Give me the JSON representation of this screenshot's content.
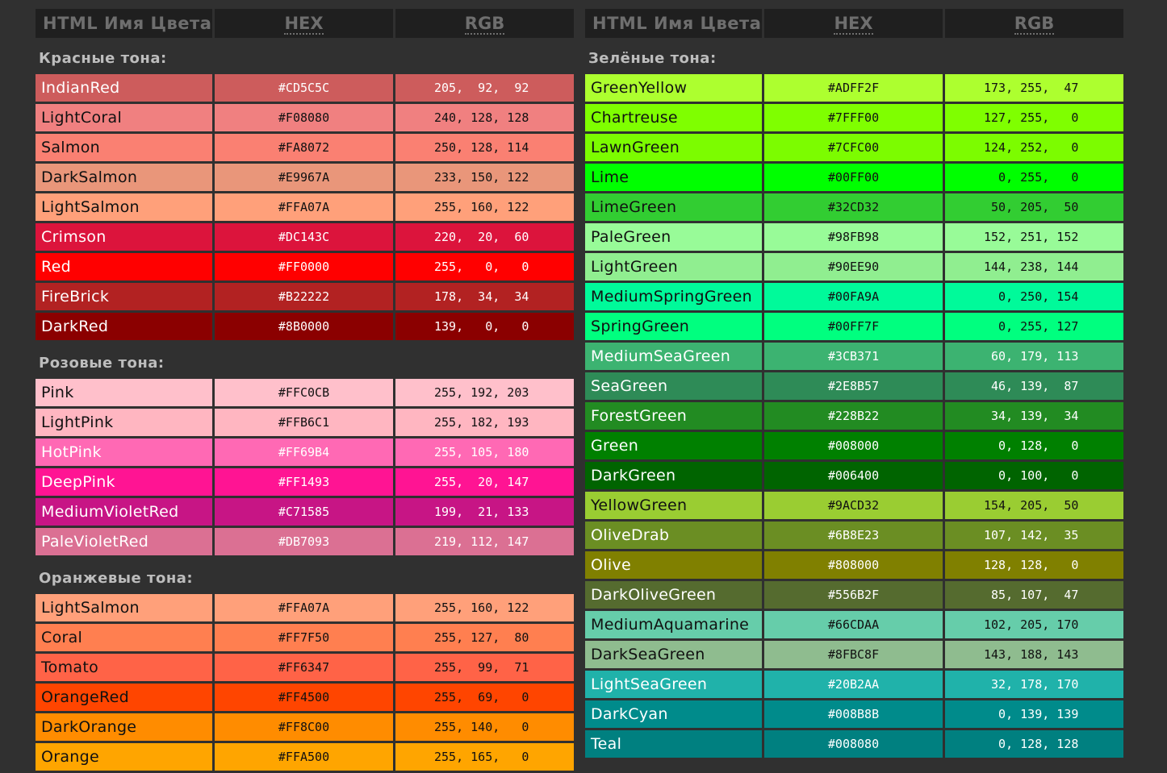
{
  "headers": {
    "name": "HTML Имя Цвета",
    "hex": "HEX",
    "rgb": "RGB"
  },
  "left": [
    {
      "title": "Красные тона:",
      "rows": [
        {
          "name": "IndianRed",
          "hex": "#CD5C5C",
          "rgb": "205,  92,  92",
          "bg": "#CD5C5C",
          "fg": "light"
        },
        {
          "name": "LightCoral",
          "hex": "#F08080",
          "rgb": "240, 128, 128",
          "bg": "#F08080",
          "fg": "dark"
        },
        {
          "name": "Salmon",
          "hex": "#FA8072",
          "rgb": "250, 128, 114",
          "bg": "#FA8072",
          "fg": "dark"
        },
        {
          "name": "DarkSalmon",
          "hex": "#E9967A",
          "rgb": "233, 150, 122",
          "bg": "#E9967A",
          "fg": "dark"
        },
        {
          "name": "LightSalmon",
          "hex": "#FFA07A",
          "rgb": "255, 160, 122",
          "bg": "#FFA07A",
          "fg": "dark"
        },
        {
          "name": "Crimson",
          "hex": "#DC143C",
          "rgb": "220,  20,  60",
          "bg": "#DC143C",
          "fg": "light"
        },
        {
          "name": "Red",
          "hex": "#FF0000",
          "rgb": "255,   0,   0",
          "bg": "#FF0000",
          "fg": "light"
        },
        {
          "name": "FireBrick",
          "hex": "#B22222",
          "rgb": "178,  34,  34",
          "bg": "#B22222",
          "fg": "light"
        },
        {
          "name": "DarkRed",
          "hex": "#8B0000",
          "rgb": "139,   0,   0",
          "bg": "#8B0000",
          "fg": "light"
        }
      ]
    },
    {
      "title": "Розовые тона:",
      "rows": [
        {
          "name": "Pink",
          "hex": "#FFC0CB",
          "rgb": "255, 192, 203",
          "bg": "#FFC0CB",
          "fg": "dark"
        },
        {
          "name": "LightPink",
          "hex": "#FFB6C1",
          "rgb": "255, 182, 193",
          "bg": "#FFB6C1",
          "fg": "dark"
        },
        {
          "name": "HotPink",
          "hex": "#FF69B4",
          "rgb": "255, 105, 180",
          "bg": "#FF69B4",
          "fg": "light"
        },
        {
          "name": "DeepPink",
          "hex": "#FF1493",
          "rgb": "255,  20, 147",
          "bg": "#FF1493",
          "fg": "light"
        },
        {
          "name": "MediumVioletRed",
          "hex": "#C71585",
          "rgb": "199,  21, 133",
          "bg": "#C71585",
          "fg": "light"
        },
        {
          "name": "PaleVioletRed",
          "hex": "#DB7093",
          "rgb": "219, 112, 147",
          "bg": "#DB7093",
          "fg": "light"
        }
      ]
    },
    {
      "title": "Оранжевые тона:",
      "rows": [
        {
          "name": "LightSalmon",
          "hex": "#FFA07A",
          "rgb": "255, 160, 122",
          "bg": "#FFA07A",
          "fg": "dark"
        },
        {
          "name": "Coral",
          "hex": "#FF7F50",
          "rgb": "255, 127,  80",
          "bg": "#FF7F50",
          "fg": "dark"
        },
        {
          "name": "Tomato",
          "hex": "#FF6347",
          "rgb": "255,  99,  71",
          "bg": "#FF6347",
          "fg": "dark"
        },
        {
          "name": "OrangeRed",
          "hex": "#FF4500",
          "rgb": "255,  69,   0",
          "bg": "#FF4500",
          "fg": "dark"
        },
        {
          "name": "DarkOrange",
          "hex": "#FF8C00",
          "rgb": "255, 140,   0",
          "bg": "#FF8C00",
          "fg": "dark"
        },
        {
          "name": "Orange",
          "hex": "#FFA500",
          "rgb": "255, 165,   0",
          "bg": "#FFA500",
          "fg": "dark"
        }
      ]
    }
  ],
  "right": [
    {
      "title": "Зелёные тона:",
      "rows": [
        {
          "name": "GreenYellow",
          "hex": "#ADFF2F",
          "rgb": "173, 255,  47",
          "bg": "#ADFF2F",
          "fg": "dark"
        },
        {
          "name": "Chartreuse",
          "hex": "#7FFF00",
          "rgb": "127, 255,   0",
          "bg": "#7FFF00",
          "fg": "dark"
        },
        {
          "name": "LawnGreen",
          "hex": "#7CFC00",
          "rgb": "124, 252,   0",
          "bg": "#7CFC00",
          "fg": "dark"
        },
        {
          "name": "Lime",
          "hex": "#00FF00",
          "rgb": "  0, 255,   0",
          "bg": "#00FF00",
          "fg": "dark"
        },
        {
          "name": "LimeGreen",
          "hex": "#32CD32",
          "rgb": " 50, 205,  50",
          "bg": "#32CD32",
          "fg": "dark"
        },
        {
          "name": "PaleGreen",
          "hex": "#98FB98",
          "rgb": "152, 251, 152",
          "bg": "#98FB98",
          "fg": "dark"
        },
        {
          "name": "LightGreen",
          "hex": "#90EE90",
          "rgb": "144, 238, 144",
          "bg": "#90EE90",
          "fg": "dark"
        },
        {
          "name": "MediumSpringGreen",
          "hex": "#00FA9A",
          "rgb": "  0, 250, 154",
          "bg": "#00FA9A",
          "fg": "dark"
        },
        {
          "name": "SpringGreen",
          "hex": "#00FF7F",
          "rgb": "  0, 255, 127",
          "bg": "#00FF7F",
          "fg": "dark"
        },
        {
          "name": "MediumSeaGreen",
          "hex": "#3CB371",
          "rgb": " 60, 179, 113",
          "bg": "#3CB371",
          "fg": "light"
        },
        {
          "name": "SeaGreen",
          "hex": "#2E8B57",
          "rgb": " 46, 139,  87",
          "bg": "#2E8B57",
          "fg": "light"
        },
        {
          "name": "ForestGreen",
          "hex": "#228B22",
          "rgb": " 34, 139,  34",
          "bg": "#228B22",
          "fg": "light"
        },
        {
          "name": "Green",
          "hex": "#008000",
          "rgb": "  0, 128,   0",
          "bg": "#008000",
          "fg": "light"
        },
        {
          "name": "DarkGreen",
          "hex": "#006400",
          "rgb": "  0, 100,   0",
          "bg": "#006400",
          "fg": "light"
        },
        {
          "name": "YellowGreen",
          "hex": "#9ACD32",
          "rgb": "154, 205,  50",
          "bg": "#9ACD32",
          "fg": "dark"
        },
        {
          "name": "OliveDrab",
          "hex": "#6B8E23",
          "rgb": "107, 142,  35",
          "bg": "#6B8E23",
          "fg": "light"
        },
        {
          "name": "Olive",
          "hex": "#808000",
          "rgb": "128, 128,   0",
          "bg": "#808000",
          "fg": "light"
        },
        {
          "name": "DarkOliveGreen",
          "hex": "#556B2F",
          "rgb": " 85, 107,  47",
          "bg": "#556B2F",
          "fg": "light"
        },
        {
          "name": "MediumAquamarine",
          "hex": "#66CDAA",
          "rgb": "102, 205, 170",
          "bg": "#66CDAA",
          "fg": "dark"
        },
        {
          "name": "DarkSeaGreen",
          "hex": "#8FBC8F",
          "rgb": "143, 188, 143",
          "bg": "#8FBC8F",
          "fg": "dark"
        },
        {
          "name": "LightSeaGreen",
          "hex": "#20B2AA",
          "rgb": " 32, 178, 170",
          "bg": "#20B2AA",
          "fg": "light"
        },
        {
          "name": "DarkCyan",
          "hex": "#008B8B",
          "rgb": "  0, 139, 139",
          "bg": "#008B8B",
          "fg": "light"
        },
        {
          "name": "Teal",
          "hex": "#008080",
          "rgb": "  0, 128, 128",
          "bg": "#008080",
          "fg": "light"
        }
      ]
    }
  ]
}
